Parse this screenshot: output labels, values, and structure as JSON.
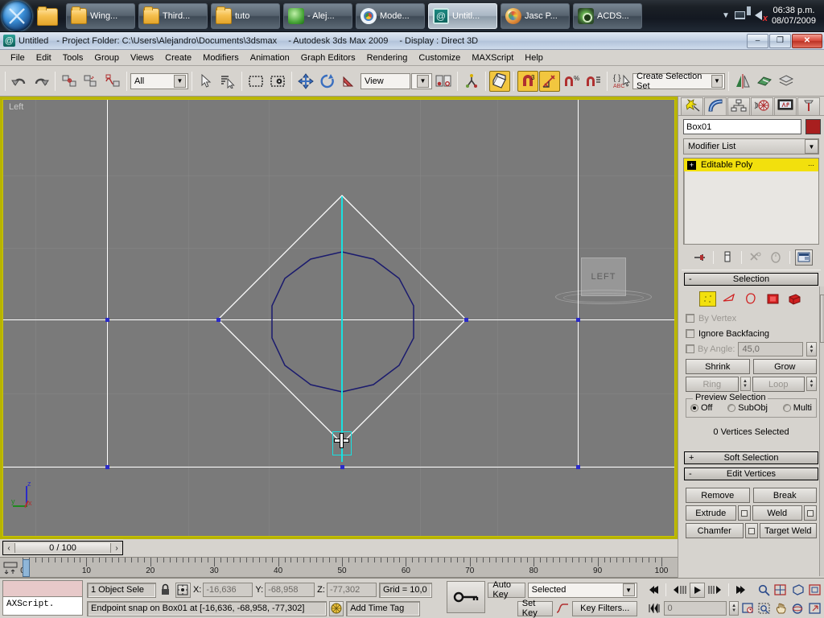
{
  "taskbar": {
    "start_label": "start-orb",
    "items": [
      {
        "label": "Wing...",
        "icon": "folder-icon"
      },
      {
        "label": "Third...",
        "icon": "folder-icon"
      },
      {
        "label": "tuto",
        "icon": "folder-icon"
      },
      {
        "label": "- Alej...",
        "icon": "messenger-icon"
      },
      {
        "label": "Mode...",
        "icon": "chrome-icon"
      },
      {
        "label": "Untitl...",
        "icon": "3dsmax-icon"
      },
      {
        "label": "Jasc P...",
        "icon": "paintshop-icon"
      },
      {
        "label": "ACDS...",
        "icon": "acdsee-icon"
      }
    ],
    "tray": {
      "overflow_arrow": "▼",
      "network_icon": "network-icon",
      "volume_icon": "volume-muted-icon"
    },
    "clock_time": "06:38 p.m.",
    "clock_date": "08/07/2009"
  },
  "titlebar": {
    "doc": "Untitled",
    "project": "- Project Folder: C:\\Users\\Alejandro\\Documents\\3dsmax",
    "app": "- Autodesk 3ds Max  2009",
    "display": "- Display : Direct 3D",
    "minimize": "–",
    "restore": "❐",
    "close": "✕"
  },
  "menubar": {
    "items": [
      "File",
      "Edit",
      "Tools",
      "Group",
      "Views",
      "Create",
      "Modifiers",
      "Animation",
      "Graph Editors",
      "Rendering",
      "Customize",
      "MAXScript",
      "Help"
    ]
  },
  "toolbar": {
    "undo": "undo-icon",
    "redo": "redo-icon",
    "select_link": "select-and-link-icon",
    "unlink": "unlink-selection-icon",
    "bind_space_warp": "bind-to-space-warp-icon",
    "selection_filter_value": "All",
    "select_object": "select-object-icon",
    "select_by_name": "select-by-name-icon",
    "select_region": "rectangular-selection-region-icon",
    "window_crossing": "window-crossing-icon",
    "select_move": "select-and-move-icon",
    "select_rotate": "select-and-rotate-icon",
    "select_scale": "select-and-scale-icon",
    "reference_coord_value": "View",
    "use_center": "use-pivot-point-center-icon",
    "mirror": "mirror-icon",
    "align": "align-icon",
    "snap_toggle": "snaps-toggle-3d-icon",
    "angle_snap": "angle-snap-toggle-icon",
    "percent_snap": "percent-snap-toggle-icon",
    "spinner_snap": "spinner-snap-toggle-icon",
    "named_sel_icon": "named-selection-sets-icon",
    "selection_set_value": "Create Selection Set",
    "mirror2": "mirror-selected-objects-icon",
    "layer_manager": "layer-manager-icon",
    "material_editor": "material-editor-icon"
  },
  "viewport": {
    "label": "Left",
    "viewcube_label": "LEFT",
    "axis_z": "z",
    "axis_y": "y",
    "axis_x": "x",
    "colors": {
      "background": "#7a7a7a",
      "grid": "#868686",
      "axis": "#ffffff",
      "vertex": "#2b2bc8",
      "spline": "#1b1b6e",
      "snap": "#19e0e0",
      "border_active": "#b8b400"
    }
  },
  "timeslider": {
    "prev_arrow": "‹",
    "frame_readout": "0 / 100",
    "next_arrow": "›"
  },
  "trackbar": {
    "key_mode_icon": "track-view-key-icon",
    "range_start": 0,
    "range_end": 100,
    "tick_labels": [
      0,
      10,
      20,
      30,
      40,
      50,
      60,
      70,
      80,
      90,
      100
    ],
    "current_frame": 0
  },
  "listener": {
    "prompt_text": "AXScript."
  },
  "status": {
    "selection_text": "1 Object Sele",
    "lock_icon": "selection-lock-icon",
    "transform_icon": "absolute-relative-transform-icon",
    "x_label": "X:",
    "x_value": "-16,636",
    "y_label": "Y:",
    "y_value": "-68,958",
    "z_label": "Z:",
    "z_value": "-77,302",
    "grid_text": "Grid = 10,0",
    "prompt_text": "Endpoint snap on Box01 at [-16,636, -68,958, -77,302]",
    "time_tag_icon": "time-tag-icon",
    "time_tag_text": "Add Time Tag",
    "key_mode_icon": "key-mode-toggle-icon",
    "auto_key": "Auto Key",
    "set_key": "Set Key",
    "key_filter_icon": "set-key-curve-icon",
    "key_filters": "Key Filters...",
    "selected_dropdown": "Selected",
    "playback": {
      "go_start": "⏮",
      "prev_frame": "◁|",
      "play": "▶",
      "next_frame": "|▷",
      "go_end": "⏭",
      "key_mode": "⏭",
      "frame_value": "0"
    },
    "nav_icons": [
      "zoom-icon",
      "zoom-all-icon",
      "zoom-extents-icon",
      "zoom-extents-all-icon",
      "field-of-view-icon",
      "zoom-region-icon",
      "pan-view-icon",
      "arc-rotate-icon",
      "maximize-viewport-icon"
    ]
  },
  "command_panel": {
    "tabs": [
      {
        "name": "create-tab",
        "icon": "create-star-icon",
        "selected": false
      },
      {
        "name": "modify-tab",
        "icon": "modify-arc-icon",
        "selected": true
      },
      {
        "name": "hierarchy-tab",
        "icon": "hierarchy-icon",
        "selected": false
      },
      {
        "name": "motion-tab",
        "icon": "motion-wheel-icon",
        "selected": false
      },
      {
        "name": "display-tab",
        "icon": "display-monitor-icon",
        "selected": false
      },
      {
        "name": "utilities-tab",
        "icon": "utilities-hammer-icon",
        "selected": false
      }
    ],
    "object_name": "Box01",
    "object_color": "#a81f1f",
    "modifier_list_label": "Modifier List",
    "stack": [
      {
        "label": "Editable Poly",
        "expanded": false
      }
    ],
    "stack_buttons": [
      "pin-stack-icon",
      "show-end-result-icon",
      "make-unique-icon",
      "remove-modifier-icon",
      "configure-modifier-sets-icon"
    ],
    "selection_rollout": {
      "title": "Selection",
      "collapse": "-",
      "subobject_icons": [
        {
          "name": "vertex-subobject-icon",
          "selected": true
        },
        {
          "name": "edge-subobject-icon",
          "selected": false
        },
        {
          "name": "border-subobject-icon",
          "selected": false
        },
        {
          "name": "polygon-subobject-icon",
          "selected": false
        },
        {
          "name": "element-subobject-icon",
          "selected": false
        }
      ],
      "by_vertex": "By Vertex",
      "ignore_backfacing": "Ignore Backfacing",
      "by_angle": "By Angle:",
      "by_angle_value": "45,0",
      "shrink": "Shrink",
      "grow": "Grow",
      "ring": "Ring",
      "loop": "Loop",
      "preview_group": "Preview Selection",
      "preview_off": "Off",
      "preview_subobj": "SubObj",
      "preview_multi": "Multi",
      "status": "0 Vertices Selected"
    },
    "soft_selection": {
      "title": "Soft Selection",
      "expand": "+"
    },
    "edit_vertices": {
      "title": "Edit Vertices",
      "collapse": "-",
      "remove": "Remove",
      "break": "Break",
      "extrude": "Extrude",
      "weld": "Weld",
      "chamfer": "Chamfer",
      "target_weld": "Target Weld"
    }
  }
}
